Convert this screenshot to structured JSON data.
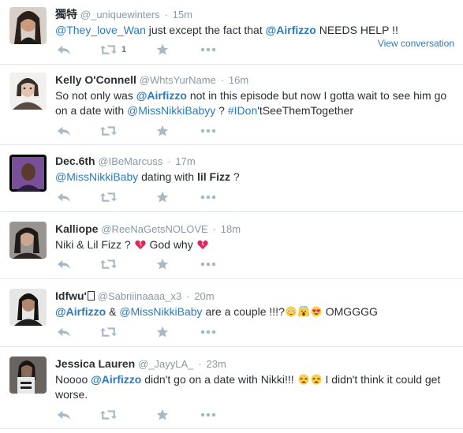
{
  "tweets": [
    {
      "fullname": "獨特",
      "handle": "@_uniquewinters",
      "time": "15m",
      "t0": "@They_love_Wan",
      "t1": " just except the fact that ",
      "t2": "@Airfizzo",
      "t3": " NEEDS HELP !!",
      "retweet_count": "1",
      "view_conversation": "View conversation"
    },
    {
      "fullname": "Kelly O'Connell",
      "handle": "@WhtsYurName",
      "time": "16m",
      "t0": "So not only was ",
      "t1": "@Airfizzo",
      "t2": " not in this episode but now I gotta wait to see him go on a date with ",
      "t3": "@MissNikkiBabyy",
      "t4": " ? ",
      "t5": "#IDon",
      "t6": "'tSeeThemTogether"
    },
    {
      "fullname": "Dec.6th",
      "handle": "@IBeMarcuss",
      "time": "17m",
      "t0": "@MissNikkiBaby",
      "t1": " dating with ",
      "t2": "lil Fizz",
      "t3": " ?"
    },
    {
      "fullname": "Kalliope",
      "handle": "@ReeNaGetsNOLOVE",
      "time": "18m",
      "t0": "Niki & Lil Fizz ? ",
      "t1": " God why ",
      "emoji": "broken-heart-icon"
    },
    {
      "fullname": "Idfwu'",
      "handle": "@Sabriiinaaaa_x3",
      "time": "20m",
      "t0": "@Airfizzo",
      "t1": " & ",
      "t2": "@MissNikkiBaby",
      "t3": " are a couple !!!?",
      "t4": " OMGGGG"
    },
    {
      "fullname": "Jessica Lauren",
      "handle": "@_JayyLA_",
      "time": "23m",
      "t0": "Noooo ",
      "t1": "@Airfizzo",
      "t2": " didn't go on a date with Nikki!!! ",
      "t3": " I didn't think it could get worse."
    }
  ],
  "colors": {
    "link": "#2b7bb9",
    "muted": "#8899a6",
    "icon": "#aab8c2",
    "heart": "#e0245e"
  }
}
